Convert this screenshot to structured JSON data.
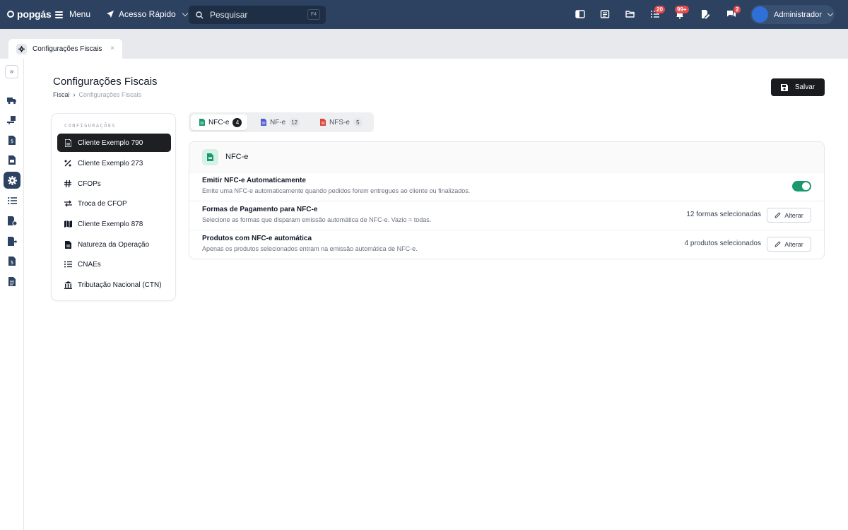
{
  "topbar": {
    "logo": "popgás",
    "menu_label": "Menu",
    "quick_access_label": "Acesso Rápido",
    "search_placeholder": "Pesquisar",
    "search_shortcut": "F4",
    "tasks_badge": "20",
    "notifications_badge": "99+",
    "messages_badge": "2",
    "user_name": "Administrador"
  },
  "page_tab": {
    "label": "Configurações Fiscais",
    "close": "×"
  },
  "page": {
    "title": "Configurações Fiscais",
    "breadcrumb": [
      "Fiscal",
      "›",
      "Configurações Fiscais"
    ],
    "save_label": "Salvar"
  },
  "config_nav": {
    "header": "CONFIGURAÇÕES",
    "items": [
      {
        "label": "Cliente Exemplo 790",
        "icon": "document-icon",
        "active": true
      },
      {
        "label": "Cliente Exemplo 273",
        "icon": "percent-icon"
      },
      {
        "label": "CFOPs",
        "icon": "hash-icon"
      },
      {
        "label": "Troca de CFOP",
        "icon": "swap-icon"
      },
      {
        "label": "Cliente Exemplo 878",
        "icon": "map-icon"
      },
      {
        "label": "Natureza da Operação",
        "icon": "file-icon"
      },
      {
        "label": "CNAEs",
        "icon": "list-icon"
      },
      {
        "label": "Tributação Nacional (CTN)",
        "icon": "bank-icon"
      }
    ]
  },
  "doc_tabs": [
    {
      "label": "NFC-e",
      "count": "4",
      "color": "#1a9a6c",
      "active": true
    },
    {
      "label": "NF-e",
      "count": "12",
      "color": "#4f5bd5"
    },
    {
      "label": "NFS-e",
      "count": "5",
      "color": "#d9483b"
    }
  ],
  "card": {
    "title": "NFC-e",
    "rows": [
      {
        "title": "Emitir NFC-e Automaticamente",
        "desc": "Emite uma NFC-e automaticamente quando pedidos forem entregues ao cliente ou finalizados.",
        "toggle_on": true
      },
      {
        "title": "Formas de Pagamento para NFC-e",
        "desc": "Selecione as formas que disparam emissão automática de NFC-e. Vazio = todas.",
        "value": "12 formas selecionadas",
        "action": "Alterar"
      },
      {
        "title": "Produtos com NFC-e automática",
        "desc": "Apenas os produtos selecionados entram na emissão automática de NFC-e.",
        "value": "4 produtos selecionados",
        "action": "Alterar"
      }
    ]
  },
  "colors": {
    "topbar": "#2c4260",
    "accent_green": "#1a9a6c",
    "badge_red": "#e5484d",
    "dark": "#1a1b1f"
  }
}
